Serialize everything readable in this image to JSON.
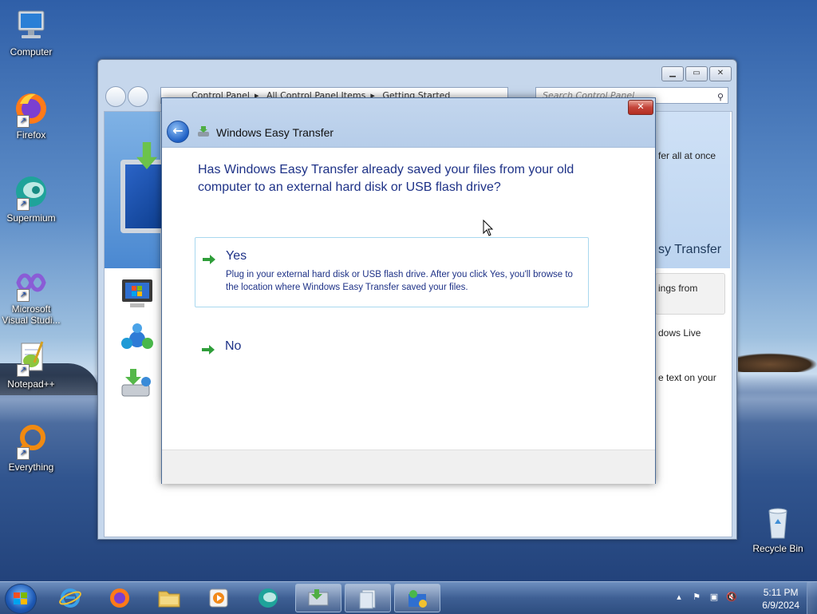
{
  "desktop": {
    "icons": [
      {
        "label": "Computer"
      },
      {
        "label": "Firefox"
      },
      {
        "label": "Supermium"
      },
      {
        "label": "Microsoft Visual Studi..."
      },
      {
        "label": "Notepad++"
      },
      {
        "label": "Everything"
      },
      {
        "label": "Recycle Bin"
      }
    ]
  },
  "explorer": {
    "breadcrumb": [
      "Control Panel",
      "All Control Panel Items",
      "Getting Started"
    ],
    "search_placeholder": "Search Control Panel",
    "right_texts": [
      "fer all at once",
      "sy Transfer",
      "ings from",
      "dows Live",
      "e text on your"
    ]
  },
  "dialog": {
    "title": "Windows Easy Transfer",
    "close_label": "✕",
    "question": "Has Windows Easy Transfer already saved your files from your old computer to an external hard disk or USB flash drive?",
    "options": [
      {
        "title": "Yes",
        "description": "Plug in your external hard disk or USB flash drive. After you click Yes, you'll browse to the location where Windows Easy Transfer saved your files."
      },
      {
        "title": "No",
        "description": ""
      }
    ]
  },
  "taskbar": {
    "clock_time": "5:11 PM",
    "clock_date": "6/9/2024"
  },
  "colors": {
    "link_blue": "#1e3287",
    "arrow_green": "#2f9e3a",
    "selection_border": "#a9d8ef"
  }
}
